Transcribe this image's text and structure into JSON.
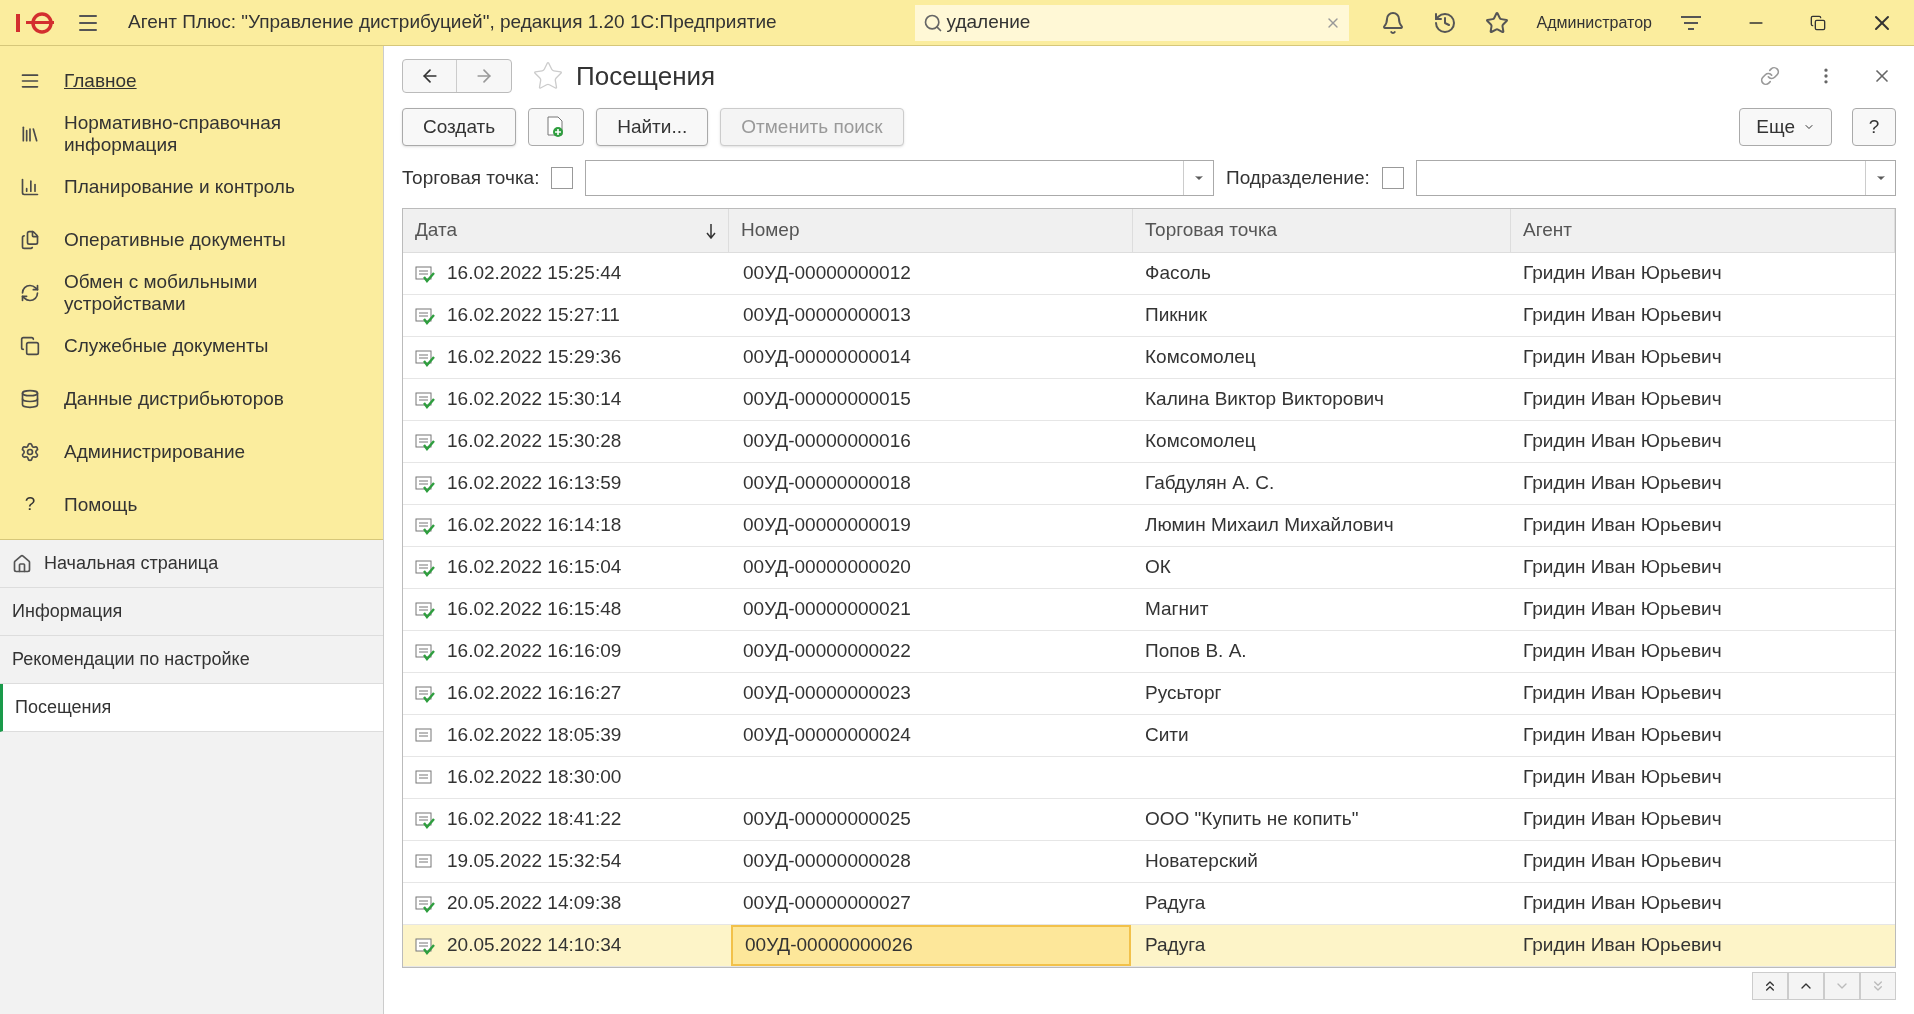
{
  "app": {
    "title": "Агент Плюс: \"Управление дистрибуцией\", редакция 1.20 1С:Предприятие",
    "search": "удаление",
    "user": "Администратор"
  },
  "sections": [
    {
      "label": "Главное",
      "selected": true
    },
    {
      "label": "Нормативно-справочная информация",
      "selected": false
    },
    {
      "label": "Планирование и контроль",
      "selected": false
    },
    {
      "label": "Оперативные документы",
      "selected": false
    },
    {
      "label": "Обмен с мобильными устройствами",
      "selected": false
    },
    {
      "label": "Служебные документы",
      "selected": false
    },
    {
      "label": "Данные дистрибьюторов",
      "selected": false
    },
    {
      "label": "Администрирование",
      "selected": false
    },
    {
      "label": "Помощь",
      "selected": false,
      "glyph": "?"
    }
  ],
  "open_windows": [
    {
      "label": "Начальная страница",
      "selected": false
    },
    {
      "label": "Информация",
      "selected": false
    },
    {
      "label": "Рекомендации по настройке",
      "selected": false
    },
    {
      "label": "Посещения",
      "selected": true
    }
  ],
  "form": {
    "title": "Посещения",
    "buttons": [
      {
        "label": "Создать",
        "disabled": false
      },
      {
        "label": "Найти...",
        "disabled": false
      },
      {
        "label": "Отменить поиск",
        "disabled": true
      }
    ],
    "more": "Еще",
    "help": "?",
    "filters": [
      {
        "label": "Торговая точка:",
        "checked": false
      },
      {
        "label": "Подразделение:",
        "checked": false
      }
    ]
  },
  "table": {
    "columns": [
      "Дата",
      "Номер",
      "Торговая точка",
      "Агент"
    ],
    "rows": [
      {
        "date": "16.02.2022 15:25:44",
        "number": "00УД-00000000012",
        "point": "Фасоль",
        "agent": "Гридин Иван Юрьевич",
        "posted": true,
        "selected": false
      },
      {
        "date": "16.02.2022 15:27:11",
        "number": "00УД-00000000013",
        "point": "Пикник",
        "agent": "Гридин Иван Юрьевич",
        "posted": true,
        "selected": false
      },
      {
        "date": "16.02.2022 15:29:36",
        "number": "00УД-00000000014",
        "point": "Комсомолец",
        "agent": "Гридин Иван Юрьевич",
        "posted": true,
        "selected": false
      },
      {
        "date": "16.02.2022 15:30:14",
        "number": "00УД-00000000015",
        "point": "Калина Виктор Викторович",
        "agent": "Гридин Иван Юрьевич",
        "posted": true,
        "selected": false
      },
      {
        "date": "16.02.2022 15:30:28",
        "number": "00УД-00000000016",
        "point": "Комсомолец",
        "agent": "Гридин Иван Юрьевич",
        "posted": true,
        "selected": false
      },
      {
        "date": "16.02.2022 16:13:59",
        "number": "00УД-00000000018",
        "point": "Габдулян А. С.",
        "agent": "Гридин Иван Юрьевич",
        "posted": true,
        "selected": false
      },
      {
        "date": "16.02.2022 16:14:18",
        "number": "00УД-00000000019",
        "point": "Люмин Михаил Михайлович",
        "agent": "Гридин Иван Юрьевич",
        "posted": true,
        "selected": false
      },
      {
        "date": "16.02.2022 16:15:04",
        "number": "00УД-00000000020",
        "point": "ОК",
        "agent": "Гридин Иван Юрьевич",
        "posted": true,
        "selected": false
      },
      {
        "date": "16.02.2022 16:15:48",
        "number": "00УД-00000000021",
        "point": "Магнит",
        "agent": "Гридин Иван Юрьевич",
        "posted": true,
        "selected": false
      },
      {
        "date": "16.02.2022 16:16:09",
        "number": "00УД-00000000022",
        "point": "Попов В. А.",
        "agent": "Гридин Иван Юрьевич",
        "posted": true,
        "selected": false
      },
      {
        "date": "16.02.2022 16:16:27",
        "number": "00УД-00000000023",
        "point": "Русьторг",
        "agent": "Гридин Иван Юрьевич",
        "posted": true,
        "selected": false
      },
      {
        "date": "16.02.2022 18:05:39",
        "number": "00УД-00000000024",
        "point": "Сити",
        "agent": "Гридин Иван Юрьевич",
        "posted": false,
        "selected": false
      },
      {
        "date": "16.02.2022 18:30:00",
        "agent": "Гридин Иван Юрьевич",
        "posted": false,
        "selected": false
      },
      {
        "date": "16.02.2022 18:41:22",
        "number": "00УД-00000000025",
        "point": "ООО \"Купить не копить\"",
        "agent": "Гридин Иван Юрьевич",
        "posted": true,
        "selected": false
      },
      {
        "date": "19.05.2022 15:32:54",
        "number": "00УД-00000000028",
        "point": "Новатерский",
        "agent": "Гридин Иван Юрьевич",
        "posted": false,
        "selected": false
      },
      {
        "date": "20.05.2022 14:09:38",
        "number": "00УД-00000000027",
        "point": "Радуга",
        "agent": "Гридин Иван Юрьевич",
        "posted": true,
        "selected": false
      },
      {
        "date": "20.05.2022 14:10:34",
        "number": "00УД-00000000026",
        "point": "Радуга",
        "agent": "Гридин Иван Юрьевич",
        "posted": true,
        "selected": true
      }
    ]
  }
}
